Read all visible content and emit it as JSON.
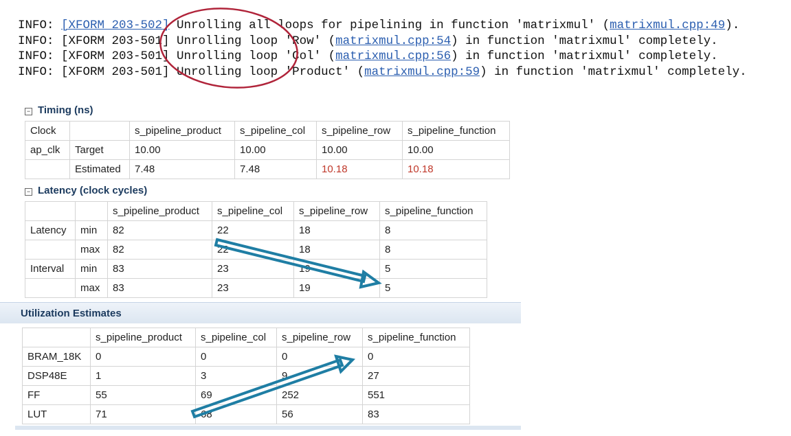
{
  "log": [
    {
      "pre": "INFO: ",
      "code": "[XFORM 203-502]",
      "code_is_link": true,
      "mid": " Unrolling all loops for pipelining in function 'matrixmul' (",
      "link": "matrixmul.cpp:49",
      "post": ")."
    },
    {
      "pre": "INFO: ",
      "code": "[XFORM 203-501]",
      "code_is_link": false,
      "mid": " Unrolling loop 'Row' (",
      "link": "matrixmul.cpp:54",
      "post": ") in function 'matrixmul' completely."
    },
    {
      "pre": "INFO: ",
      "code": "[XFORM 203-501]",
      "code_is_link": false,
      "mid": " Unrolling loop 'Col' (",
      "link": "matrixmul.cpp:56",
      "post": ") in function 'matrixmul' completely."
    },
    {
      "pre": "INFO: ",
      "code": "[XFORM 203-501]",
      "code_is_link": false,
      "mid": " Unrolling loop 'Product' (",
      "link": "matrixmul.cpp:59",
      "post": ") in function 'matrixmul' completely."
    }
  ],
  "timing": {
    "title": "Timing (ns)",
    "collapse_glyph": "−",
    "headers": [
      "Clock",
      "",
      "s_pipeline_product",
      "s_pipeline_col",
      "s_pipeline_row",
      "s_pipeline_function"
    ],
    "rows": [
      {
        "c0": "ap_clk",
        "c1": "Target",
        "values": [
          "10.00",
          "10.00",
          "10.00",
          "10.00"
        ]
      },
      {
        "c0": "",
        "c1": "Estimated",
        "values": [
          "7.48",
          "7.48",
          "10.18",
          "10.18"
        ]
      }
    ],
    "highlight_color": "#c0392b"
  },
  "latency": {
    "title": "Latency (clock cycles)",
    "collapse_glyph": "−",
    "headers": [
      "",
      "",
      "s_pipeline_product",
      "s_pipeline_col",
      "s_pipeline_row",
      "s_pipeline_function"
    ],
    "rows": [
      {
        "c0": "Latency",
        "c1": "min",
        "values": [
          "82",
          "22",
          "18",
          "8"
        ]
      },
      {
        "c0": "",
        "c1": "max",
        "values": [
          "82",
          "22",
          "18",
          "8"
        ]
      },
      {
        "c0": "Interval",
        "c1": "min",
        "values": [
          "83",
          "23",
          "19",
          "5"
        ]
      },
      {
        "c0": "",
        "c1": "max",
        "values": [
          "83",
          "23",
          "19",
          "5"
        ]
      }
    ]
  },
  "utilization": {
    "title": "Utilization Estimates",
    "headers": [
      "",
      "s_pipeline_product",
      "s_pipeline_col",
      "s_pipeline_row",
      "s_pipeline_function"
    ],
    "rows": [
      {
        "c0": "BRAM_18K",
        "values": [
          "0",
          "0",
          "0",
          "0"
        ]
      },
      {
        "c0": "DSP48E",
        "values": [
          "1",
          "3",
          "9",
          "27"
        ]
      },
      {
        "c0": "FF",
        "values": [
          "55",
          "69",
          "252",
          "551"
        ]
      },
      {
        "c0": "LUT",
        "values": [
          "71",
          "68",
          "56",
          "83"
        ]
      }
    ]
  },
  "annotations": {
    "ellipse_color": "#b0243a",
    "arrow_color": "#1f7ea4"
  }
}
